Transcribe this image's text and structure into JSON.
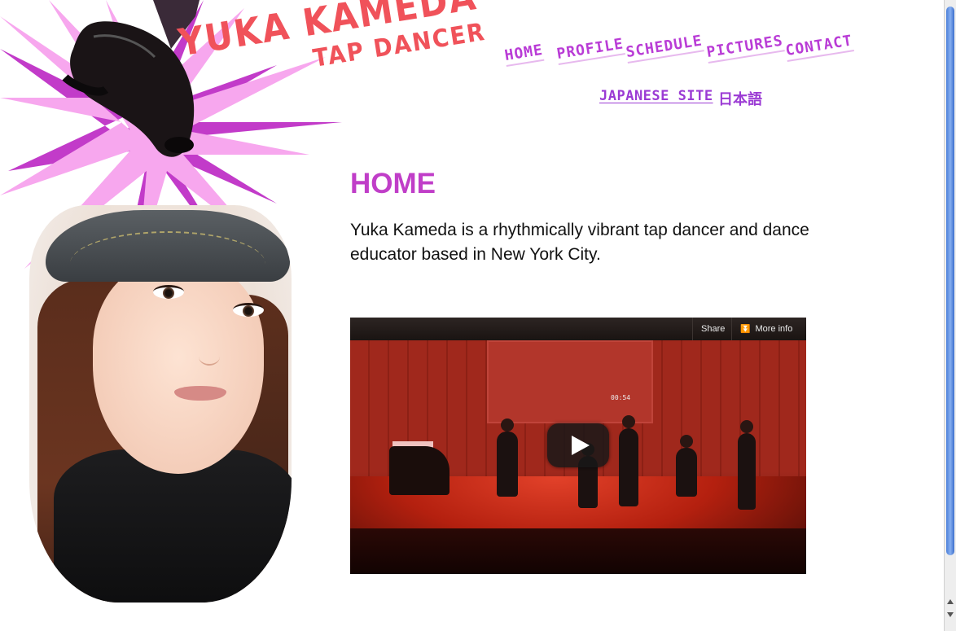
{
  "logo": {
    "name": "YUKA KAMEDA",
    "role": "TAP DANCER"
  },
  "nav": {
    "home": "HOME",
    "profile": "PROFILE",
    "schedule": "SCHEDULE",
    "pictures": "PICTURES",
    "contact": "CONTACT",
    "japanese_site": "JAPANESE SITE",
    "japanese_label": "日本語"
  },
  "main": {
    "title": "HOME",
    "intro": "Yuka Kameda is a rhythmically vibrant tap dancer and dance educator based in New York City."
  },
  "video": {
    "share_label": "Share",
    "more_info_label": "More info",
    "more_info_icon": "double-chevron-down-icon",
    "play_icon": "play-icon",
    "timer": "00:54"
  },
  "colors": {
    "nav": "#b93cd6",
    "title": "#c03ec8",
    "logo": "#f0525a",
    "burst_light": "#f7a7ee",
    "burst_dark": "#c23bc9"
  }
}
